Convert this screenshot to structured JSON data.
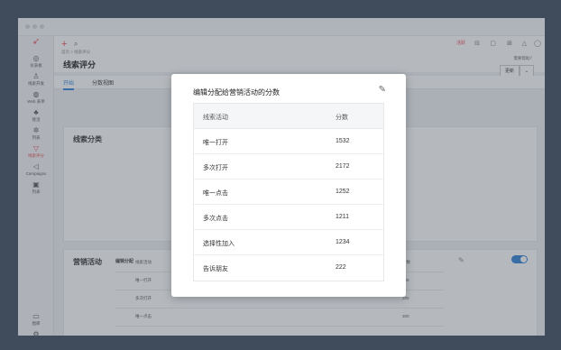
{
  "window": {
    "controls": [
      "close",
      "minimize",
      "maximize"
    ]
  },
  "sidebar": {
    "items": [
      {
        "icon": "compass-icon",
        "glyph": "◎",
        "label": "仪表板"
      },
      {
        "icon": "user-icon",
        "glyph": "♙",
        "label": "线索开发"
      },
      {
        "icon": "globe-icon",
        "glyph": "◍",
        "label": "Web 表单"
      },
      {
        "icon": "org-icon",
        "glyph": "♣",
        "label": "接洽"
      },
      {
        "icon": "gear-icon",
        "glyph": "✲",
        "label": "列表"
      },
      {
        "icon": "filter-icon",
        "glyph": "▽",
        "label": "线索评分"
      },
      {
        "icon": "megaphone-icon",
        "glyph": "◁",
        "label": "Campaigns"
      },
      {
        "icon": "report-icon",
        "glyph": "▣",
        "label": "列表"
      },
      {
        "icon": "image-icon",
        "glyph": "▭",
        "label": "图库"
      },
      {
        "icon": "settings-icon",
        "glyph": "⚙",
        "label": "设置"
      }
    ]
  },
  "topbar": {
    "breadcrumb": "首页 > 线索评分",
    "page_title": "线索评分",
    "red_label": "活跃",
    "help": "需要帮助？",
    "btn_label": "更新"
  },
  "tabs": [
    "开始",
    "分数视图"
  ],
  "background": {
    "section1_title": "线索分类",
    "section2_title": "营销活动",
    "edit_label": "编辑分配",
    "table_header": [
      "线索活动",
      "分数"
    ],
    "rows": [
      [
        "唯一打开",
        "100"
      ],
      [
        "多次打开",
        "200"
      ],
      [
        "唯一点击",
        "300"
      ]
    ]
  },
  "modal": {
    "title": "编辑分配给营销活动的分数",
    "header": [
      "线索活动",
      "分数"
    ],
    "rows": [
      {
        "activity": "唯一打开",
        "score": "1532"
      },
      {
        "activity": "多次打开",
        "score": "2172"
      },
      {
        "activity": "唯一点击",
        "score": "1252"
      },
      {
        "activity": "多次点击",
        "score": "1211"
      },
      {
        "activity": "选择性加入",
        "score": "1234"
      },
      {
        "activity": "告诉朋友",
        "score": "222"
      }
    ]
  },
  "colors": {
    "accent": "#2f7fd4",
    "brand": "#e5484d",
    "backdrop": "#3c4a5c"
  }
}
